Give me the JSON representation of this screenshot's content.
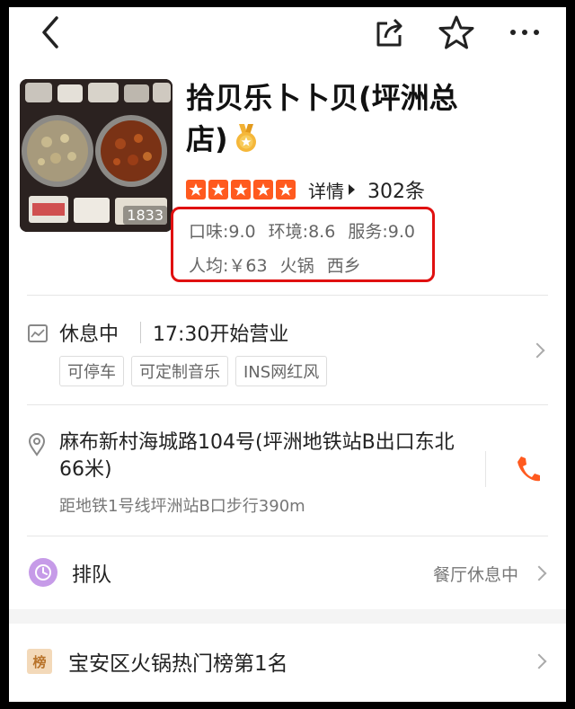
{
  "topbar": {
    "back": "back-icon",
    "share": "share-icon",
    "favorite": "star-icon",
    "more": "more-icon"
  },
  "shop": {
    "photo_count": "1833",
    "name": "拾贝乐卜卜贝(坪洲总店)",
    "badge": "medal-icon",
    "star_rating": 5,
    "star_color": "#ff5a1f",
    "detail_label": "详情",
    "review_count": "302条",
    "scores": [
      "口味:9.0",
      "环境:8.6",
      "服务:9.0"
    ],
    "meta": [
      "人均:￥63",
      "火锅",
      "西乡"
    ],
    "highlight_color": "#e01010"
  },
  "hours": {
    "status": "休息中",
    "open_time": "17:30开始营业",
    "tags": [
      "可停车",
      "可定制音乐",
      "INS网红风"
    ]
  },
  "address": {
    "text": "麻布新村海城路104号(坪洲地铁站B出口东北66米)",
    "distance": "距地铁1号线坪洲站B口步行390m",
    "phone_color": "#ff5a1f"
  },
  "queue": {
    "label": "排队",
    "status": "餐厅休息中"
  },
  "ranking": {
    "icon_text": "榜",
    "label": "宝安区火锅热门榜第1名"
  }
}
